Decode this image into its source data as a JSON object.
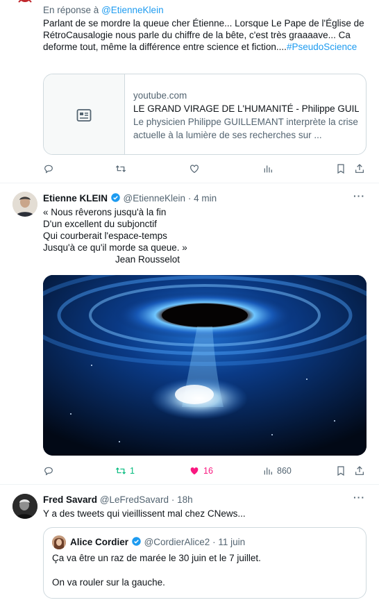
{
  "tweet1": {
    "reply_prefix": "En réponse à ",
    "reply_handle": "@EtienneKlein",
    "text_main": "Parlant de se mordre la queue cher Étienne... Lorsque Le Pape de l'Église de RétroCausalogie nous parle du chiffre de la bête, c'est très graaaave... Ca deforme tout, même la différence entre science et fiction....",
    "hashtag": "#PseudoScience",
    "card": {
      "domain": "youtube.com",
      "title": "LE GRAND VIRAGE DE L'HUMANITÉ - Philippe GUILLEMANT",
      "description": "Le physicien Philippe GUILLEMANT interprète la crise actuelle à la lumière de ses recherches sur ..."
    }
  },
  "tweet2": {
    "name": "Etienne KLEIN",
    "handle": "@EtienneKlein",
    "time": "4 min",
    "lines": [
      "« Nous rêverons jusqu'à la fin",
      "D'un excellent du subjonctif",
      "Qui courberait l'espace-temps",
      "Jusqu'à ce qu'il morde sa queue. »",
      "Jean Rousselot"
    ],
    "retweets": "1",
    "likes": "16",
    "views": "860"
  },
  "tweet3": {
    "name": "Fred Savard",
    "handle": "@LeFredSavard",
    "time": "18h",
    "text": "Y a des tweets qui vieillissent mal chez CNews...",
    "quote": {
      "name": "Alice Cordier",
      "handle": "@CordierAlice2",
      "time": "11 juin",
      "line1": "Ça va être un raz de marée le 30 juin et le 7 juillet.",
      "line2": "On va rouler sur la gauche."
    }
  },
  "colors": {
    "accent": "#1d9bf0",
    "retweet": "#00ba7c",
    "like": "#f91880",
    "muted": "#536471"
  }
}
